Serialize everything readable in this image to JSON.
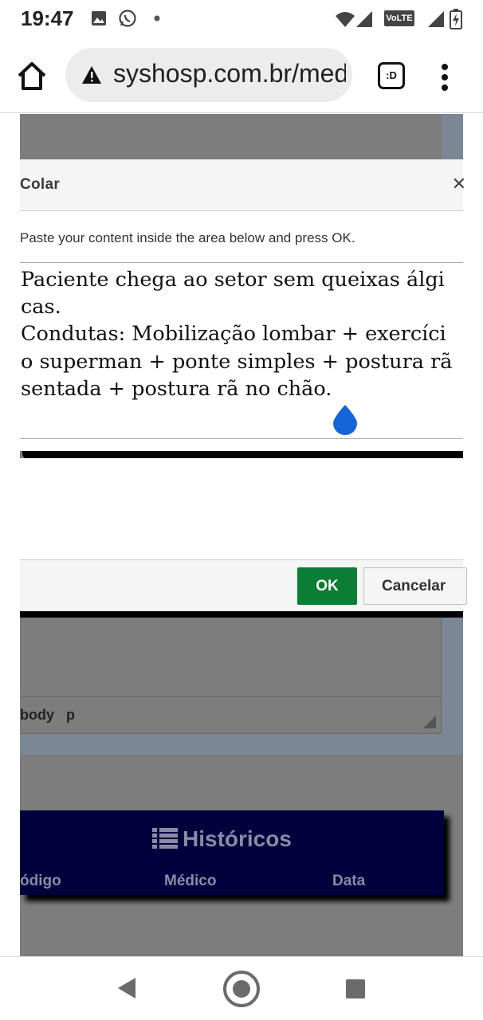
{
  "status_bar": {
    "time": "19:47",
    "icons": [
      "image-icon",
      "whatsapp-icon",
      "dot-icon",
      "wifi-icon",
      "signal-icon",
      "signal-icon",
      "battery-charging-icon"
    ],
    "volte": "VoLTE"
  },
  "browser": {
    "url": "syshosp.com.br/med",
    "tab_label": ":D",
    "security": "not-secure-warning-icon"
  },
  "dialog": {
    "title": "Colar",
    "instruction": "Paste your content inside the area below and press OK.",
    "content_lines": [
      "Paciente chega ao setor sem queixas álgi",
      "cas.",
      "Condutas: Mobilização lombar + exercíci",
      "o superman + ponte simples + postura rã",
      "sentada + postura rã no chão."
    ],
    "ok_label": "OK",
    "cancel_label": "Cancelar",
    "ok_color": "#0b7d34"
  },
  "editor": {
    "path_body": "body",
    "path_p": "p"
  },
  "historicos": {
    "title": "Históricos",
    "columns": [
      "ódigo",
      "Médico",
      "Data"
    ],
    "background": "#00003c"
  }
}
